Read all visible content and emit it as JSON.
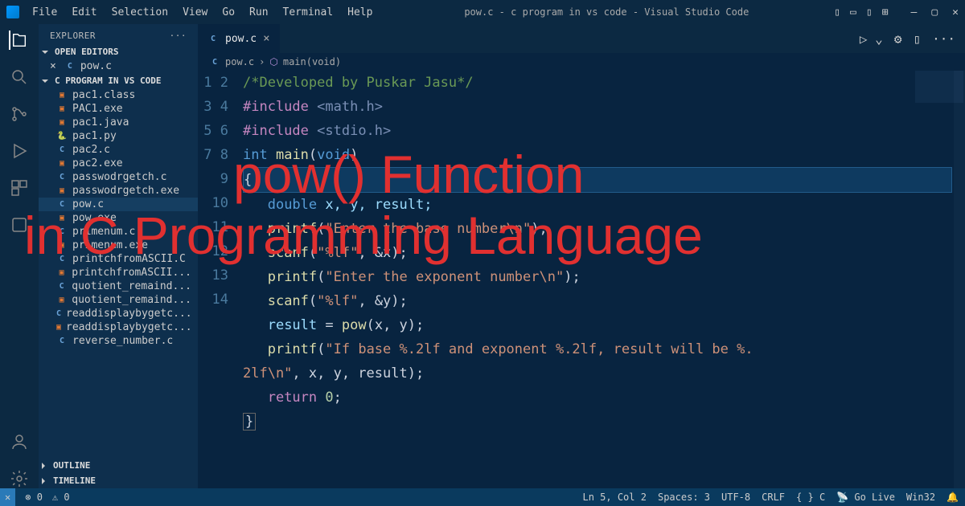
{
  "title": "pow.c - c program in vs code - Visual Studio Code",
  "menu": [
    "File",
    "Edit",
    "Selection",
    "View",
    "Go",
    "Run",
    "Terminal",
    "Help"
  ],
  "explorer": {
    "header": "EXPLORER",
    "openEditors": "OPEN EDITORS",
    "workspace": "C PROGRAM IN VS CODE",
    "outline": "OUTLINE",
    "timeline": "TIMELINE",
    "openFile": "pow.c",
    "files": [
      {
        "name": "pac1.class",
        "icon": "class"
      },
      {
        "name": "PAC1.exe",
        "icon": "exe"
      },
      {
        "name": "pac1.java",
        "icon": "java"
      },
      {
        "name": "pac1.py",
        "icon": "py"
      },
      {
        "name": "pac2.c",
        "icon": "c"
      },
      {
        "name": "pac2.exe",
        "icon": "exe"
      },
      {
        "name": "passwodrgetch.c",
        "icon": "c"
      },
      {
        "name": "passwodrgetch.exe",
        "icon": "exe"
      },
      {
        "name": "pow.c",
        "icon": "c",
        "selected": true
      },
      {
        "name": "pow.exe",
        "icon": "exe"
      },
      {
        "name": "primenum.c",
        "icon": "c"
      },
      {
        "name": "primenum.exe",
        "icon": "exe"
      },
      {
        "name": "printchfromASCII.C",
        "icon": "c"
      },
      {
        "name": "printchfromASCII...",
        "icon": "exe"
      },
      {
        "name": "quotient_remaind...",
        "icon": "c"
      },
      {
        "name": "quotient_remaind...",
        "icon": "exe"
      },
      {
        "name": "readdisplaybygetc...",
        "icon": "c"
      },
      {
        "name": "readdisplaybygetc...",
        "icon": "exe"
      },
      {
        "name": "reverse_number.c",
        "icon": "c"
      }
    ]
  },
  "tab": {
    "label": "pow.c"
  },
  "breadcrumb": {
    "file": "pow.c",
    "symbol": "main(void)"
  },
  "code": {
    "1": {
      "comment": "/*Developed by Puskar Jasu*/"
    },
    "2": {
      "inc": "#include",
      "lib": "<math.h>"
    },
    "3": {
      "inc": "#include",
      "lib": "<stdio.h>"
    },
    "4": {
      "type": "int",
      "func": "main",
      "args": "void"
    },
    "5": {
      "brace": "{"
    },
    "6": {
      "type": "double",
      "vars": "x, y, result;"
    },
    "7": {
      "func": "printf",
      "str": "\"Enter the base number\\n\""
    },
    "8": {
      "func": "scanf",
      "str": "\"%lf\"",
      "arg": ", &x"
    },
    "9": {
      "func": "printf",
      "str": "\"Enter the exponent number\\n\""
    },
    "10": {
      "func": "scanf",
      "str": "\"%lf\"",
      "arg": ", &y"
    },
    "11": {
      "var": "result",
      "func": "pow",
      "args": "x, y"
    },
    "12": {
      "func": "printf",
      "str": "\"If base %.2lf and exponent %.2lf, result will be %.2lf\\n\"",
      "arg": ", x, y, result"
    },
    "13": {
      "kw": "return",
      "val": "0"
    },
    "14": {
      "brace": "}"
    }
  },
  "status": {
    "errors": "0",
    "warnings": "0",
    "pos": "Ln 5, Col 2",
    "spaces": "Spaces: 3",
    "encoding": "UTF-8",
    "eol": "CRLF",
    "lang": "C",
    "golive": "Go Live",
    "platform": "Win32"
  },
  "overlay": {
    "line1": "pow() Function",
    "line2": "in C Programming Language"
  }
}
